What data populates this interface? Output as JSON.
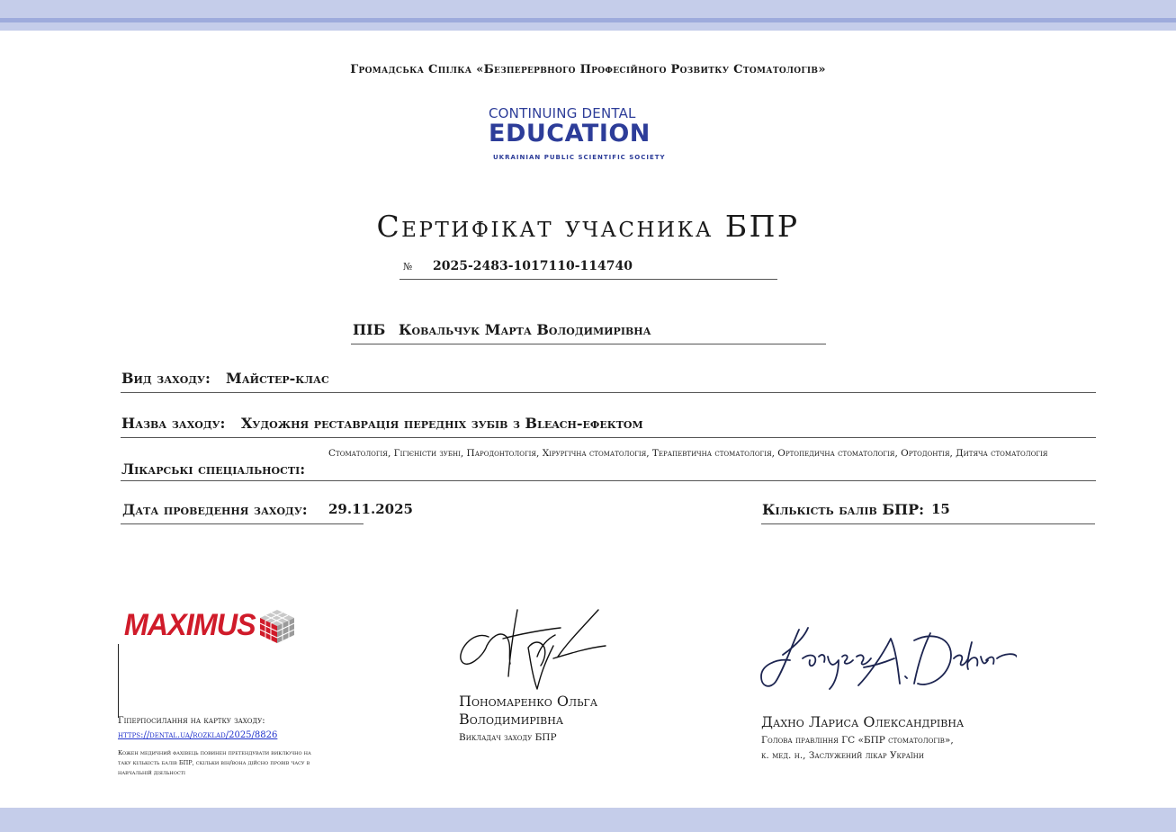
{
  "organization": "Громадська Спілка «Безперервного Професійного Розвитку Стоматологів»",
  "logo": {
    "line1": "CONTINUING DENTAL",
    "line2": "EDUCATION",
    "line3": "UKRAINIAN PUBLIC SCIENTIFIC SOCIETY",
    "color": "#2d3d99"
  },
  "title": "Сертифікат учасника БПР",
  "certificate": {
    "number_symbol": "№",
    "number": "2025-2483-1017110-114740"
  },
  "participant": {
    "label": "ПІБ",
    "name": "Ковальчук Марта Володимирівна"
  },
  "event": {
    "type_label": "Вид заходу:",
    "type_value": "Майстер-клас",
    "name_label": "Назва заходу:",
    "name_value": "Художня реставрація передніх зубів з Bleach-ефектом",
    "specialties_label": "Лікарські спеціальності:",
    "specialties_value": "Стоматологія, Гігієністи зубні, Пародонтологія, Хірургічна стоматологія, Терапевтична стоматологія, Ортопедична стоматологія, Ортодонтія, Дитяча стоматологія",
    "date_label": "Дата проведення заходу:",
    "date_value": "29.11.2025",
    "points_label": "Кількість балів БПР:",
    "points_value": "15"
  },
  "partner": {
    "logo_text": "MAXIMUS",
    "logo_color": "#d01b2a",
    "link_label": "Гіперпосилання на картку заходу:",
    "link_value": "https://dental.ua/rozklad/2025/8826",
    "note": "Кожен медичний фахівець повинен претендувати виключно на таку кількість балів БПР, скільки він/вона дійсно провів часу в навчальній діяльності"
  },
  "signatory1": {
    "name_line1": "Пономаренко Ольга",
    "name_line2": "Володимирівна",
    "role": "Викладач заходу БПР"
  },
  "signatory2": {
    "signature_text": "Larysa A. Dakhno",
    "name": "Дахно Лариса Олександрівна",
    "role_line1": "Голова правління ГС «БПР стоматологів»,",
    "role_line2": "к. мед. н., Заслужений лікар України"
  },
  "colors": {
    "band": "#c5cdea",
    "band_line": "#9eabdc",
    "signature_ink": "#1c2450"
  }
}
